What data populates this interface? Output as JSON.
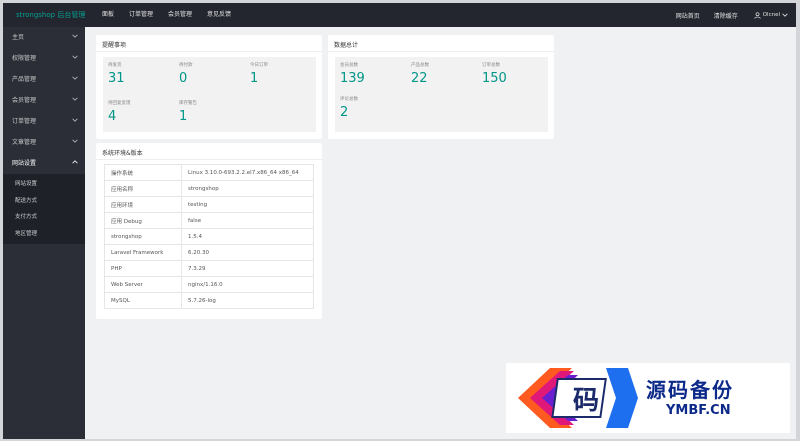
{
  "header": {
    "brand": "strongshop 后台管理",
    "nav": [
      "面板",
      "订单管理",
      "会员管理",
      "意见反馈"
    ],
    "site_home": "网站首页",
    "clear_cache": "清除缓存",
    "user_name": "Olcnel"
  },
  "sidebar": {
    "items": [
      {
        "label": "主页"
      },
      {
        "label": "权限管理"
      },
      {
        "label": "产品管理"
      },
      {
        "label": "会员管理"
      },
      {
        "label": "订单管理"
      },
      {
        "label": "文章管理"
      },
      {
        "label": "网站设置"
      }
    ],
    "sub_items": [
      {
        "label": "网站设置"
      },
      {
        "label": "配送方式"
      },
      {
        "label": "支付方式"
      },
      {
        "label": "地区管理"
      }
    ]
  },
  "reminders": {
    "title": "提醒事项",
    "stats": [
      {
        "label": "待发货",
        "value": "31"
      },
      {
        "label": "待付款",
        "value": "0"
      },
      {
        "label": "今日订单",
        "value": "1"
      },
      {
        "label": "待回复反馈",
        "value": "4"
      },
      {
        "label": "库存警告",
        "value": "1"
      }
    ]
  },
  "totals": {
    "title": "数据总计",
    "stats": [
      {
        "label": "会员总数",
        "value": "139"
      },
      {
        "label": "产品总数",
        "value": "22"
      },
      {
        "label": "订单总数",
        "value": "150"
      },
      {
        "label": "评论总数",
        "value": "2"
      }
    ]
  },
  "env": {
    "title": "系统环境&版本",
    "rows": [
      {
        "key": "操作系统",
        "value": "Linux 3.10.0-693.2.2.el7.x86_64 x86_64"
      },
      {
        "key": "应用名称",
        "value": "strongshop"
      },
      {
        "key": "应用环境",
        "value": "testing"
      },
      {
        "key": "应用 Debug",
        "value": "false"
      },
      {
        "key": "strongshop",
        "value": "1.5.4"
      },
      {
        "key": "Laravel Framework",
        "value": "6.20.30"
      },
      {
        "key": "PHP",
        "value": "7.3.29"
      },
      {
        "key": "Web Server",
        "value": "nginx/1.16.0"
      },
      {
        "key": "MySQL",
        "value": "5.7.26-log"
      }
    ]
  },
  "watermark": {
    "title": "源码备份",
    "url": "YMBF.CN",
    "logo_char": "码"
  },
  "colors": {
    "accent": "#009688",
    "topbar": "#23262e",
    "sidebar": "#2b2e37",
    "watermark_blue": "#0d2a8a"
  }
}
